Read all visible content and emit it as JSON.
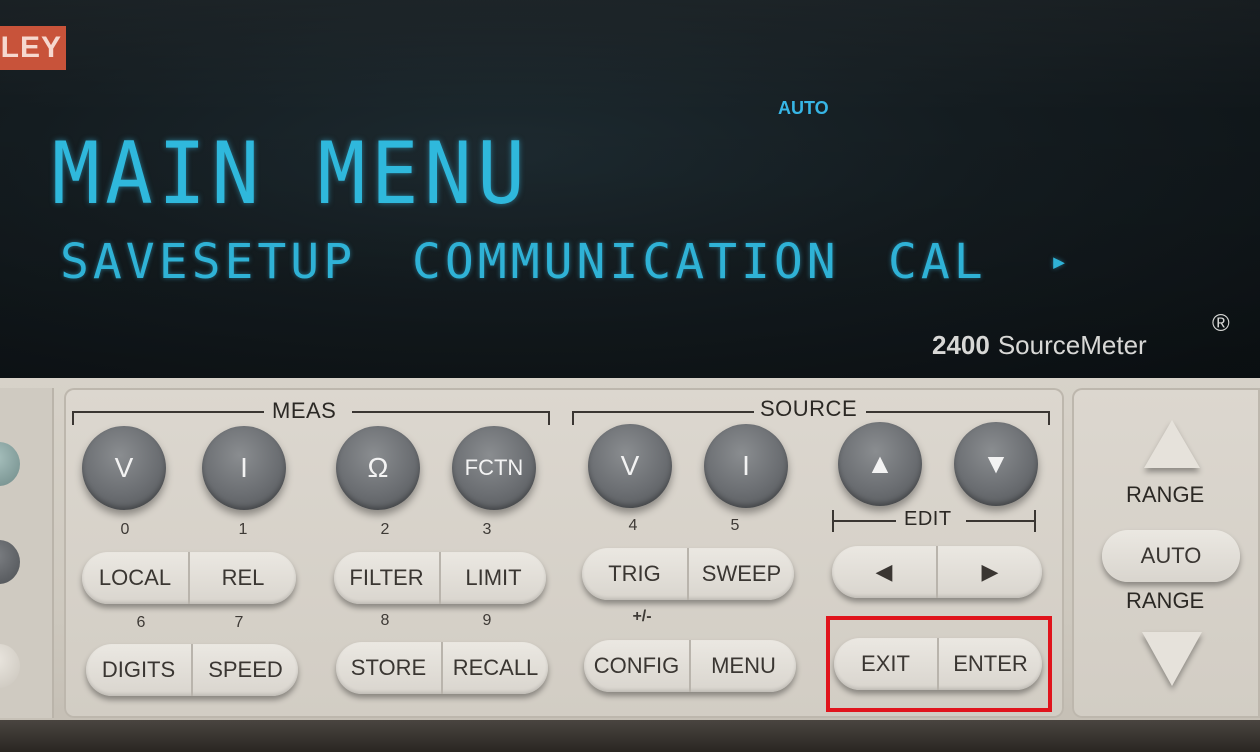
{
  "display": {
    "brand_fragment": "LEY",
    "annunciator": "AUTO",
    "line1": "MAIN MENU",
    "menu_items": [
      "SAVESETUP",
      "COMMUNICATION",
      "CAL"
    ],
    "more_indicator": "▸",
    "model_number": "2400",
    "model_name": "SourceMeter",
    "registered": "®"
  },
  "meas": {
    "title": "MEAS",
    "keys": [
      "V",
      "I",
      "Ω",
      "FCTN"
    ],
    "numbers": [
      "0",
      "1",
      "2",
      "3"
    ]
  },
  "source": {
    "title": "SOURCE",
    "keys": [
      "V",
      "I",
      "▲",
      "▼"
    ],
    "numbers": [
      "4",
      "5"
    ]
  },
  "edit": {
    "title": "EDIT",
    "left": "◀",
    "right": "▶"
  },
  "row2": {
    "local": "LOCAL",
    "rel": "REL",
    "filter": "FILTER",
    "limit": "LIMIT",
    "trig": "TRIG",
    "sweep": "SWEEP"
  },
  "row3_numbers": [
    "6",
    "7",
    "8",
    "9"
  ],
  "plus_minus": "+/-",
  "row3": {
    "digits": "DIGITS",
    "speed": "SPEED",
    "store": "STORE",
    "recall": "RECALL",
    "config": "CONFIG",
    "menu": "MENU",
    "exit": "EXIT",
    "enter": "ENTER"
  },
  "range": {
    "top_label": "RANGE",
    "auto": "AUTO",
    "bottom_label": "RANGE"
  },
  "colors": {
    "vfd": "#2fb8dc",
    "highlight": "#e0141c",
    "key_gray": "#6b6e72",
    "panel": "#d2cdc4"
  }
}
